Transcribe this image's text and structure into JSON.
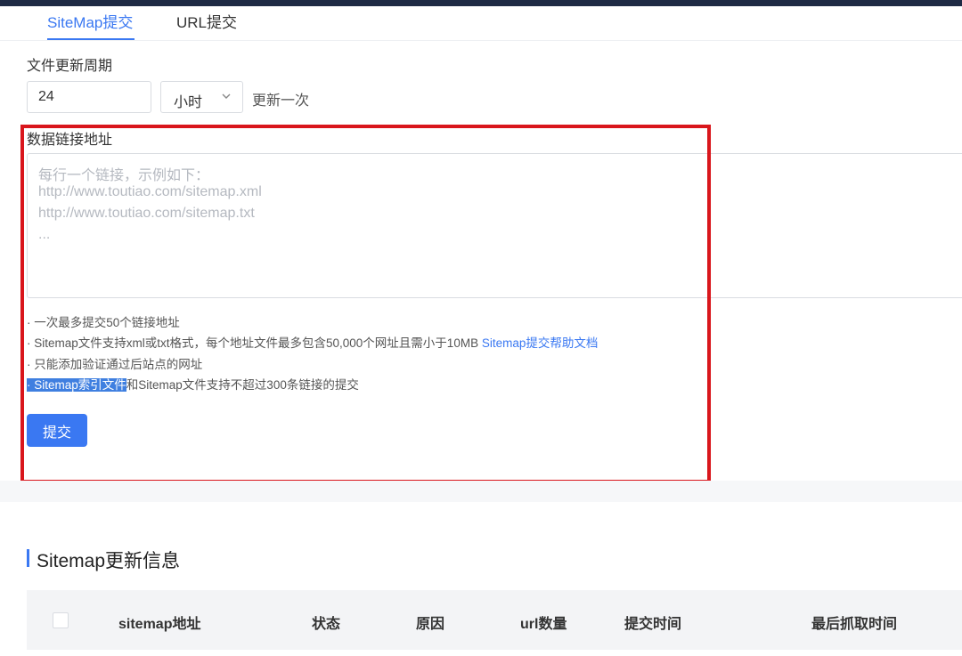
{
  "tabs": [
    {
      "label": "SiteMap提交",
      "active": true
    },
    {
      "label": "URL提交",
      "active": false
    }
  ],
  "update_cycle": {
    "label": "文件更新周期",
    "value": "24",
    "unit": "小时",
    "suffix": "更新一次"
  },
  "data_links": {
    "label": "数据链接地址",
    "placeholder_lines": [
      "每行一个链接，示例如下：",
      "http://www.toutiao.com/sitemap.xml",
      "http://www.toutiao.com/sitemap.txt",
      "..."
    ]
  },
  "notes": {
    "n1": "· 一次最多提交50个链接地址",
    "n2_text": "· Sitemap文件支持xml或txt格式，每个地址文件最多包含50,000个网址且需小于10MB ",
    "n2_link": "Sitemap提交帮助文档",
    "n3": "· 只能添加验证通过后站点的网址",
    "n4_highlight": "· Sitemap索引文件",
    "n4_text": "和Sitemap文件支持不超过300条链接的提交"
  },
  "submit_label": "提交",
  "section": {
    "title": "Sitemap更新信息"
  },
  "table": {
    "columns": [
      "sitemap地址",
      "状态",
      "原因",
      "url数量",
      "提交时间",
      "最后抓取时间"
    ]
  },
  "colors": {
    "accent": "#3a78f2",
    "annotation_box": "#d9161c",
    "topbar": "#1f2a44"
  },
  "icons": {
    "select_arrow": "chevron-down-icon"
  }
}
